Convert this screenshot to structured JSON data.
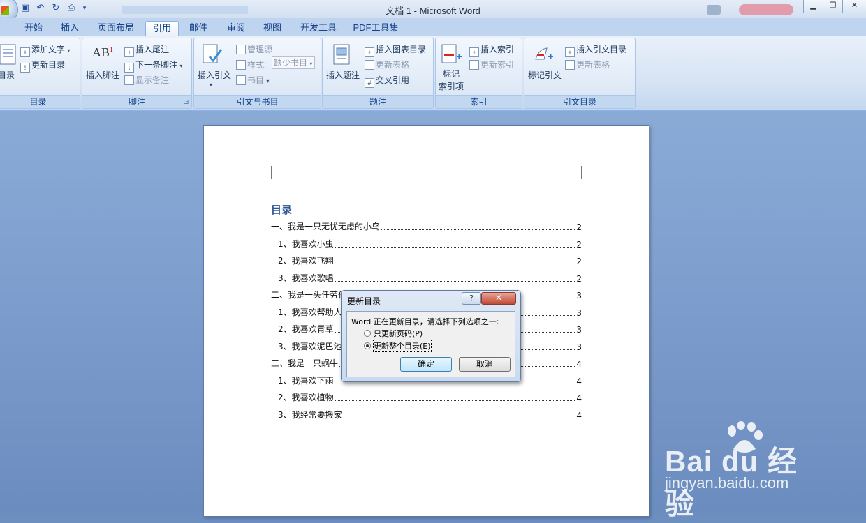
{
  "window": {
    "title": "文档 1 - Microsoft Word"
  },
  "tabs": [
    "开始",
    "插入",
    "页面布局",
    "引用",
    "邮件",
    "审阅",
    "视图",
    "开发工具",
    "PDF工具集"
  ],
  "active_tab": "引用",
  "ribbon": {
    "toc": {
      "big_label": "目录",
      "add_text": "添加文字",
      "update_toc": "更新目录",
      "group": "目录"
    },
    "footnotes": {
      "insert_footnote": "插入脚注",
      "insert_endnote": "插入尾注",
      "next_footnote": "下一条脚注",
      "show_notes": "显示备注",
      "group": "脚注",
      "ab_icon": "AB"
    },
    "citations": {
      "insert_citation": "插入引文",
      "manage_sources": "管理源",
      "style_label": "样式:",
      "style_value": "缺少书目",
      "bibliography": "书目",
      "group": "引文与书目"
    },
    "captions": {
      "insert_caption": "插入题注",
      "insert_table_of_figures": "插入图表目录",
      "update_table": "更新表格",
      "cross_reference": "交叉引用",
      "group": "题注"
    },
    "index": {
      "mark_entry_1": "标记",
      "mark_entry_2": "索引项",
      "insert_index": "插入索引",
      "update_index": "更新索引",
      "group": "索引"
    },
    "authorities": {
      "mark_citation": "标记引文",
      "insert_toa": "插入引文目录",
      "update_table": "更新表格",
      "group": "引文目录"
    }
  },
  "document": {
    "toc_heading": "目录",
    "toc": [
      {
        "text": "一、我是一只无忧无虑的小鸟",
        "page": "2",
        "level": 1
      },
      {
        "text": "1、我喜欢小虫",
        "page": "2",
        "level": 2
      },
      {
        "text": "2、我喜欢飞翔",
        "page": "2",
        "level": 2
      },
      {
        "text": "3、我喜欢歌唱",
        "page": "2",
        "level": 2
      },
      {
        "text": "二、我是一头任劳任",
        "page": "3",
        "level": 1
      },
      {
        "text": "1、我喜欢帮助人",
        "page": "3",
        "level": 2
      },
      {
        "text": "2、我喜欢青草",
        "page": "3",
        "level": 2
      },
      {
        "text": "3、我喜欢泥巴池",
        "page": "3",
        "level": 2
      },
      {
        "text": "三、我是一只蜗牛",
        "page": "4",
        "level": 1
      },
      {
        "text": "1、我喜欢下雨",
        "page": "4",
        "level": 2
      },
      {
        "text": "2、我喜欢植物",
        "page": "4",
        "level": 2
      },
      {
        "text": "3、我经常要搬家",
        "page": "4",
        "level": 2
      }
    ]
  },
  "dialog": {
    "title": "更新目录",
    "help": "?",
    "close": "✕",
    "prompt": "Word 正在更新目录，请选择下列选项之一:",
    "option_page_numbers": "只更新页码(P)",
    "option_entire_table": "更新整个目录(E)",
    "selected": "option_entire_table",
    "ok": "确定",
    "cancel": "取消"
  },
  "watermark": {
    "brand": "Bai du 经验",
    "url": "jingyan.baidu.com"
  }
}
